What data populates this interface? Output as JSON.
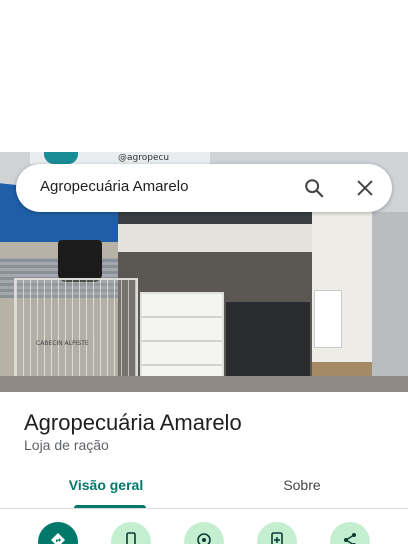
{
  "search": {
    "query": "Agropecuária Amarelo"
  },
  "photo": {
    "sign_handle": "@agropecu",
    "cage_tag": "CABECIN ALPISTE"
  },
  "place": {
    "title": "Agropecuária Amarelo",
    "category": "Loja de ração"
  },
  "tabs": [
    {
      "label": "Visão geral",
      "selected": true
    },
    {
      "label": "Sobre",
      "selected": false
    }
  ],
  "actions": [
    {
      "icon": "directions-icon"
    },
    {
      "icon": "phone-icon"
    },
    {
      "icon": "location-icon"
    },
    {
      "icon": "add-doc-icon"
    },
    {
      "icon": "share-icon"
    }
  ],
  "colors": {
    "accent": "#00796b",
    "action_bg": "#c4eed0"
  }
}
